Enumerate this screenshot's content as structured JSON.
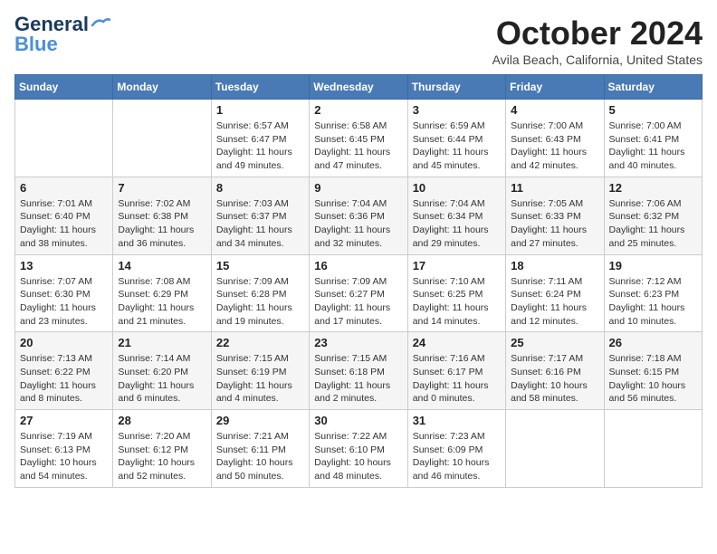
{
  "header": {
    "logo_line1": "General",
    "logo_line2": "Blue",
    "month_title": "October 2024",
    "location": "Avila Beach, California, United States"
  },
  "weekdays": [
    "Sunday",
    "Monday",
    "Tuesday",
    "Wednesday",
    "Thursday",
    "Friday",
    "Saturday"
  ],
  "weeks": [
    [
      {
        "day": "",
        "info": ""
      },
      {
        "day": "",
        "info": ""
      },
      {
        "day": "1",
        "info": "Sunrise: 6:57 AM\nSunset: 6:47 PM\nDaylight: 11 hours and 49 minutes."
      },
      {
        "day": "2",
        "info": "Sunrise: 6:58 AM\nSunset: 6:45 PM\nDaylight: 11 hours and 47 minutes."
      },
      {
        "day": "3",
        "info": "Sunrise: 6:59 AM\nSunset: 6:44 PM\nDaylight: 11 hours and 45 minutes."
      },
      {
        "day": "4",
        "info": "Sunrise: 7:00 AM\nSunset: 6:43 PM\nDaylight: 11 hours and 42 minutes."
      },
      {
        "day": "5",
        "info": "Sunrise: 7:00 AM\nSunset: 6:41 PM\nDaylight: 11 hours and 40 minutes."
      }
    ],
    [
      {
        "day": "6",
        "info": "Sunrise: 7:01 AM\nSunset: 6:40 PM\nDaylight: 11 hours and 38 minutes."
      },
      {
        "day": "7",
        "info": "Sunrise: 7:02 AM\nSunset: 6:38 PM\nDaylight: 11 hours and 36 minutes."
      },
      {
        "day": "8",
        "info": "Sunrise: 7:03 AM\nSunset: 6:37 PM\nDaylight: 11 hours and 34 minutes."
      },
      {
        "day": "9",
        "info": "Sunrise: 7:04 AM\nSunset: 6:36 PM\nDaylight: 11 hours and 32 minutes."
      },
      {
        "day": "10",
        "info": "Sunrise: 7:04 AM\nSunset: 6:34 PM\nDaylight: 11 hours and 29 minutes."
      },
      {
        "day": "11",
        "info": "Sunrise: 7:05 AM\nSunset: 6:33 PM\nDaylight: 11 hours and 27 minutes."
      },
      {
        "day": "12",
        "info": "Sunrise: 7:06 AM\nSunset: 6:32 PM\nDaylight: 11 hours and 25 minutes."
      }
    ],
    [
      {
        "day": "13",
        "info": "Sunrise: 7:07 AM\nSunset: 6:30 PM\nDaylight: 11 hours and 23 minutes."
      },
      {
        "day": "14",
        "info": "Sunrise: 7:08 AM\nSunset: 6:29 PM\nDaylight: 11 hours and 21 minutes."
      },
      {
        "day": "15",
        "info": "Sunrise: 7:09 AM\nSunset: 6:28 PM\nDaylight: 11 hours and 19 minutes."
      },
      {
        "day": "16",
        "info": "Sunrise: 7:09 AM\nSunset: 6:27 PM\nDaylight: 11 hours and 17 minutes."
      },
      {
        "day": "17",
        "info": "Sunrise: 7:10 AM\nSunset: 6:25 PM\nDaylight: 11 hours and 14 minutes."
      },
      {
        "day": "18",
        "info": "Sunrise: 7:11 AM\nSunset: 6:24 PM\nDaylight: 11 hours and 12 minutes."
      },
      {
        "day": "19",
        "info": "Sunrise: 7:12 AM\nSunset: 6:23 PM\nDaylight: 11 hours and 10 minutes."
      }
    ],
    [
      {
        "day": "20",
        "info": "Sunrise: 7:13 AM\nSunset: 6:22 PM\nDaylight: 11 hours and 8 minutes."
      },
      {
        "day": "21",
        "info": "Sunrise: 7:14 AM\nSunset: 6:20 PM\nDaylight: 11 hours and 6 minutes."
      },
      {
        "day": "22",
        "info": "Sunrise: 7:15 AM\nSunset: 6:19 PM\nDaylight: 11 hours and 4 minutes."
      },
      {
        "day": "23",
        "info": "Sunrise: 7:15 AM\nSunset: 6:18 PM\nDaylight: 11 hours and 2 minutes."
      },
      {
        "day": "24",
        "info": "Sunrise: 7:16 AM\nSunset: 6:17 PM\nDaylight: 11 hours and 0 minutes."
      },
      {
        "day": "25",
        "info": "Sunrise: 7:17 AM\nSunset: 6:16 PM\nDaylight: 10 hours and 58 minutes."
      },
      {
        "day": "26",
        "info": "Sunrise: 7:18 AM\nSunset: 6:15 PM\nDaylight: 10 hours and 56 minutes."
      }
    ],
    [
      {
        "day": "27",
        "info": "Sunrise: 7:19 AM\nSunset: 6:13 PM\nDaylight: 10 hours and 54 minutes."
      },
      {
        "day": "28",
        "info": "Sunrise: 7:20 AM\nSunset: 6:12 PM\nDaylight: 10 hours and 52 minutes."
      },
      {
        "day": "29",
        "info": "Sunrise: 7:21 AM\nSunset: 6:11 PM\nDaylight: 10 hours and 50 minutes."
      },
      {
        "day": "30",
        "info": "Sunrise: 7:22 AM\nSunset: 6:10 PM\nDaylight: 10 hours and 48 minutes."
      },
      {
        "day": "31",
        "info": "Sunrise: 7:23 AM\nSunset: 6:09 PM\nDaylight: 10 hours and 46 minutes."
      },
      {
        "day": "",
        "info": ""
      },
      {
        "day": "",
        "info": ""
      }
    ]
  ]
}
